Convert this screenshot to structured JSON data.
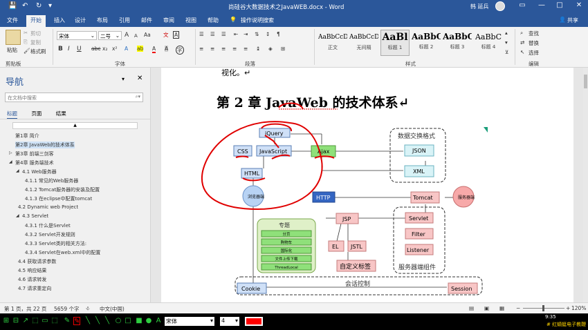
{
  "window": {
    "title": "尚硅谷大数据技术之JavaWEB.docx  -  Word",
    "user": "韩 延兵",
    "controls": [
      "▭",
      "—",
      "□",
      "✕"
    ],
    "quick_access": [
      "💾",
      "↶",
      "↻",
      "▾"
    ]
  },
  "menu_tabs": [
    "文件",
    "开始",
    "插入",
    "设计",
    "布局",
    "引用",
    "邮件",
    "审阅",
    "视图",
    "帮助",
    "操作说明搜索"
  ],
  "share_label": "共享",
  "ribbon": {
    "clipboard": {
      "paste": "粘贴",
      "cut": "剪切",
      "copy": "复制",
      "format_painter": "格式刷",
      "label": "剪贴板"
    },
    "font": {
      "name": "宋体",
      "size": "二号",
      "label": "字体",
      "bold": "B",
      "italic": "I",
      "underline": "U",
      "strike": "abc",
      "sub": "x₂",
      "sup": "x²",
      "clear": "Aa",
      "grow": "A",
      "shrink": "A",
      "ruby": "文",
      "char_border": "A",
      "effects": "A",
      "highlight": "ab",
      "color": "A",
      "char_shade": "A",
      "enclose": "字"
    },
    "paragraph": {
      "label": "段落"
    },
    "styles": {
      "label": "样式",
      "items": [
        {
          "preview": "AaBbCcDc",
          "name": "正文"
        },
        {
          "preview": "AaBbCcDc",
          "name": "无间隔"
        },
        {
          "preview": "AaBl",
          "name": "标题 1"
        },
        {
          "preview": "AaBbC",
          "name": "标题 2"
        },
        {
          "preview": "AaBbC",
          "name": "标题 3"
        },
        {
          "preview": "AaBbC",
          "name": "标题 4"
        }
      ]
    },
    "editing": {
      "find": "查找",
      "replace": "替换",
      "select": "选择",
      "label": "编辑"
    }
  },
  "nav": {
    "title": "导航",
    "search_placeholder": "在文档中搜索",
    "tabs": [
      "标题",
      "页面",
      "结果"
    ],
    "items": [
      {
        "text": "第1章 简介",
        "level": 0
      },
      {
        "text": "第2章 JavaWeb的技术体系",
        "level": 0
      },
      {
        "text": "第3章 前端三剑客",
        "level": 0
      },
      {
        "text": "第4章 服务端技术",
        "level": 0
      },
      {
        "text": "4.1 Web服务器",
        "level": 1
      },
      {
        "text": "4.1.1 常见的Web服务器",
        "level": 2
      },
      {
        "text": "4.1.2 Tomcat服务器的安装及配置",
        "level": 2
      },
      {
        "text": "4.1.3 在eclipse中配置tomcat",
        "level": 2
      },
      {
        "text": "4.2 Dynamic web Project",
        "level": 1
      },
      {
        "text": "4.3 Servlet",
        "level": 1
      },
      {
        "text": "4.3.1 什么是Servlet",
        "level": 2
      },
      {
        "text": "4.3.2 Servlet开发规则",
        "level": 2
      },
      {
        "text": "4.3.3 Servlet类的相关方法:",
        "level": 2
      },
      {
        "text": "4.3.4 Servlet在web.xml中的配置",
        "level": 2
      },
      {
        "text": "4.4 获取请求参数",
        "level": 1
      },
      {
        "text": "4.5 响应结果",
        "level": 1
      },
      {
        "text": "4.6 请求转发",
        "level": 1
      },
      {
        "text": "4.7 请求重定向",
        "level": 1
      }
    ]
  },
  "doc": {
    "top_text": "视化。↵",
    "heading": "第 2 章  JavaWeb 的技术体系↵",
    "diagram": {
      "jquery": "jQuery",
      "css": "CSS",
      "javascript": "JavaScript",
      "html": "HTML",
      "ajax": "Ajax",
      "browser": "浏览器端",
      "data_title": "数据交换格式",
      "json": "JSON",
      "xml": "XML",
      "http": "HTTP",
      "tomcat": "Tomcat",
      "server": "服务器端",
      "jsp": "JSP",
      "el": "EL",
      "jstl": "JSTL",
      "custom_tags": "自定义标签",
      "topics_title": "专题",
      "topics": [
        "分页",
        "购物车",
        "国际化",
        "文件上传下载",
        "ThreadLocal"
      ],
      "servlet": "Servlet",
      "filter": "Filter",
      "listener": "Listener",
      "server_components": "服务器端组件",
      "session_control": "会话控制",
      "cookie": "Cookie",
      "session": "Session"
    }
  },
  "status": {
    "page": "第 1 页，共 22 页",
    "words": "5659 个字",
    "lang": "中文(中国)",
    "zoom": "120%",
    "zoom_minus": "−",
    "zoom_plus": "+"
  },
  "drawbar": {
    "font": "宋体",
    "size": "4",
    "time": "9:35",
    "ticker": "# 红蜻蜓电子教鞭 #",
    "tools": [
      "⊞",
      "⊟",
      "↗",
      "⬚",
      "▭",
      "⬚",
      "✎",
      "✎",
      "╲",
      "╲",
      "╲",
      "○",
      "□",
      "■",
      "●",
      "A"
    ],
    "colors": {
      "tool": "#2ecc40",
      "pen": "#ff0000"
    }
  },
  "colors": {
    "word_blue": "#2b579a",
    "box_blue": "#cfe0f7",
    "box_green": "#8fe07a",
    "box_cyan": "#d9f3f7",
    "box_pink": "#f8c6c6",
    "http_blue": "#3465c2",
    "annotation": "#e00000"
  }
}
